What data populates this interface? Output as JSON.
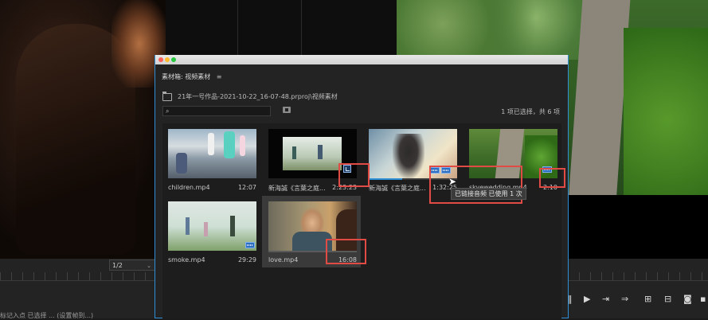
{
  "panel": {
    "title": "素材箱: 视频素材",
    "menu_icon": "≡",
    "path": "21年一号作品-2021-10-22_16-07-48.prproj\\视频素材",
    "search_placeholder": "",
    "selection_count": "1 项已选择，共 6 项"
  },
  "clips": [
    {
      "name": "children.mp4",
      "duration": "12:07"
    },
    {
      "name": "新海誠《言葉之庭...",
      "duration": "2:23:23"
    },
    {
      "name": "新海誠《言葉之庭...",
      "duration": "1:32:25"
    },
    {
      "name": "skyewedding.mp4",
      "duration": "2:10"
    },
    {
      "name": "smoke.mp4",
      "duration": "29:29"
    },
    {
      "name": "love.mp4",
      "duration": "16:08"
    }
  ],
  "tooltip": "已链接音频 已使用 1 次",
  "program": {
    "zoom": "1/2",
    "status": "标记入点 已选择 ... (设置帧到...)"
  },
  "icons": {
    "play": "play-icon",
    "step_forward": "step-forward-icon",
    "insert": "insert-icon",
    "lift": "lift-icon",
    "extract": "extract-icon",
    "export_frame": "camera-icon"
  },
  "colors": {
    "accent": "#2f8fd6",
    "annotation": "#e04b46",
    "badge": "#2f6fc2"
  }
}
